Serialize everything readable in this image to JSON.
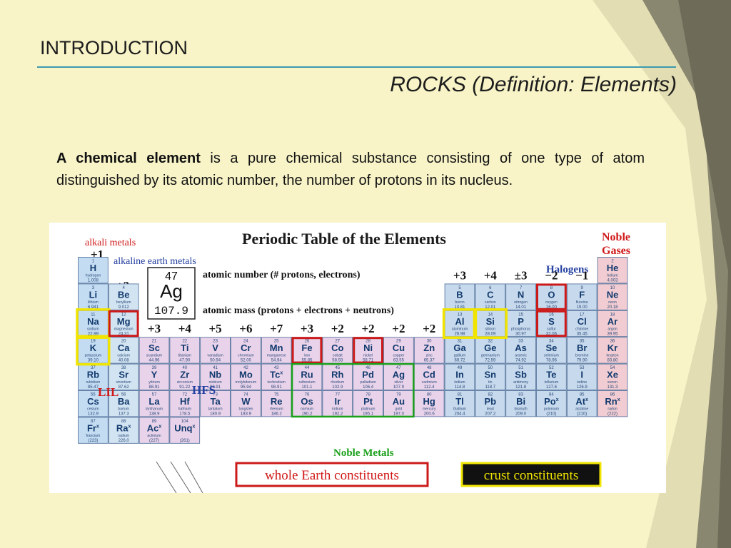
{
  "slide": {
    "title": "INTRODUCTION",
    "subtitle": "ROCKS (Definition: Elements)",
    "paragraph": {
      "term": "A chemical element",
      "rest": " is a pure chemical substance consisting of one type of atom distinguished by its atomic number, the number of protons in its nucleus."
    }
  },
  "table": {
    "title": "Periodic Table of the Elements",
    "alkali_label": "alkali metals",
    "alkaline_label": "alkaline earth metals",
    "noble_label": [
      "Noble",
      "Gases"
    ],
    "halogens_label": "Halogens",
    "noble_metals_label": "Noble Metals",
    "whole_earth_label": "whole Earth constituents",
    "crust_label": "crust constituents",
    "lil_label": "LIL",
    "hfs_label": "HFS",
    "key": {
      "number": "47",
      "symbol": "Ag",
      "mass": "107.9",
      "number_desc": "atomic number (# protons, electrons)",
      "mass_desc": "atomic mass (protons + electrons + neutrons)"
    },
    "charges": {
      "c1": "+1",
      "c2": "+2",
      "t3": "+3",
      "t4": "+4",
      "t5": "+5",
      "t6": "+6",
      "t7": "+7",
      "t8": "+3",
      "t9": "+2",
      "t10": "+2",
      "t11": "+2",
      "t12": "+2",
      "p13": "+3",
      "p14": "+4",
      "p15": "±3",
      "p16": "−2",
      "p17": "−1"
    },
    "colors": {
      "alkali_fill": "#c3dcf2",
      "alkaline_fill": "#d2e4f2",
      "transition_fill": "#e9d3ea",
      "pblock_fill": "#c7d9ec",
      "noble_fill": "#f1ccd2",
      "cell_border": "#4a6a96",
      "highlight_red": "#cc1a1a",
      "highlight_yellow": "#f0e400",
      "noble_metals_green": "#1aa01a"
    },
    "elements": [
      {
        "z": "1",
        "s": "H",
        "n": "hydrogen",
        "m": "1.008",
        "col": 1,
        "row": 1
      },
      {
        "z": "2",
        "s": "He",
        "n": "helium",
        "m": "4.003",
        "col": 18,
        "row": 1
      },
      {
        "z": "3",
        "s": "Li",
        "n": "lithium",
        "m": "6.941",
        "col": 1,
        "row": 2
      },
      {
        "z": "4",
        "s": "Be",
        "n": "beryllium",
        "m": "9.012",
        "col": 2,
        "row": 2
      },
      {
        "z": "5",
        "s": "B",
        "n": "boron",
        "m": "10.81",
        "col": 13,
        "row": 2
      },
      {
        "z": "6",
        "s": "C",
        "n": "carbon",
        "m": "12.01",
        "col": 14,
        "row": 2
      },
      {
        "z": "7",
        "s": "N",
        "n": "nitrogen",
        "m": "14.01",
        "col": 15,
        "row": 2
      },
      {
        "z": "8",
        "s": "O",
        "n": "oxygen",
        "m": "16.00",
        "col": 16,
        "row": 2
      },
      {
        "z": "9",
        "s": "F",
        "n": "fluorine",
        "m": "19.00",
        "col": 17,
        "row": 2
      },
      {
        "z": "10",
        "s": "Ne",
        "n": "neon",
        "m": "20.18",
        "col": 18,
        "row": 2
      },
      {
        "z": "11",
        "s": "Na",
        "n": "sodium",
        "m": "22.99",
        "col": 1,
        "row": 3
      },
      {
        "z": "12",
        "s": "Mg",
        "n": "magnesium",
        "m": "24.31",
        "col": 2,
        "row": 3
      },
      {
        "z": "13",
        "s": "Al",
        "n": "aluminum",
        "m": "26.98",
        "col": 13,
        "row": 3
      },
      {
        "z": "14",
        "s": "Si",
        "n": "silicon",
        "m": "28.09",
        "col": 14,
        "row": 3
      },
      {
        "z": "15",
        "s": "P",
        "n": "phosphorus",
        "m": "30.97",
        "col": 15,
        "row": 3
      },
      {
        "z": "16",
        "s": "S",
        "n": "sulfur",
        "m": "32.06",
        "col": 16,
        "row": 3
      },
      {
        "z": "17",
        "s": "Cl",
        "n": "chlorine",
        "m": "35.45",
        "col": 17,
        "row": 3
      },
      {
        "z": "18",
        "s": "Ar",
        "n": "argon",
        "m": "39.95",
        "col": 18,
        "row": 3
      },
      {
        "z": "19",
        "s": "K",
        "n": "potassium",
        "m": "39.10",
        "col": 1,
        "row": 4
      },
      {
        "z": "20",
        "s": "Ca",
        "n": "calcium",
        "m": "40.08",
        "col": 2,
        "row": 4
      },
      {
        "z": "21",
        "s": "Sc",
        "n": "scandium",
        "m": "44.96",
        "col": 3,
        "row": 4
      },
      {
        "z": "22",
        "s": "Ti",
        "n": "titanium",
        "m": "47.90",
        "col": 4,
        "row": 4
      },
      {
        "z": "23",
        "s": "V",
        "n": "vanadium",
        "m": "50.94",
        "col": 5,
        "row": 4
      },
      {
        "z": "24",
        "s": "Cr",
        "n": "chromium",
        "m": "52.00",
        "col": 6,
        "row": 4
      },
      {
        "z": "25",
        "s": "Mn",
        "n": "manganese",
        "m": "54.94",
        "col": 7,
        "row": 4
      },
      {
        "z": "26",
        "s": "Fe",
        "n": "iron",
        "m": "55.85",
        "col": 8,
        "row": 4
      },
      {
        "z": "27",
        "s": "Co",
        "n": "cobalt",
        "m": "58.93",
        "col": 9,
        "row": 4
      },
      {
        "z": "28",
        "s": "Ni",
        "n": "nickel",
        "m": "58.71",
        "col": 10,
        "row": 4
      },
      {
        "z": "29",
        "s": "Cu",
        "n": "copper",
        "m": "63.55",
        "col": 11,
        "row": 4
      },
      {
        "z": "30",
        "s": "Zn",
        "n": "zinc",
        "m": "65.37",
        "col": 12,
        "row": 4
      },
      {
        "z": "31",
        "s": "Ga",
        "n": "gallium",
        "m": "69.72",
        "col": 13,
        "row": 4
      },
      {
        "z": "32",
        "s": "Ge",
        "n": "germanium",
        "m": "72.59",
        "col": 14,
        "row": 4
      },
      {
        "z": "33",
        "s": "As",
        "n": "arsenic",
        "m": "74.92",
        "col": 15,
        "row": 4
      },
      {
        "z": "34",
        "s": "Se",
        "n": "selenium",
        "m": "78.96",
        "col": 16,
        "row": 4
      },
      {
        "z": "35",
        "s": "Br",
        "n": "bromine",
        "m": "79.90",
        "col": 17,
        "row": 4
      },
      {
        "z": "36",
        "s": "Kr",
        "n": "krypton",
        "m": "83.80",
        "col": 18,
        "row": 4
      },
      {
        "z": "37",
        "s": "Rb",
        "n": "rubidium",
        "m": "85.47",
        "col": 1,
        "row": 5
      },
      {
        "z": "38",
        "s": "Sr",
        "n": "strontium",
        "m": "87.62",
        "col": 2,
        "row": 5
      },
      {
        "z": "39",
        "s": "Y",
        "n": "yttrium",
        "m": "88.91",
        "col": 3,
        "row": 5
      },
      {
        "z": "40",
        "s": "Zr",
        "n": "zirconium",
        "m": "91.22",
        "col": 4,
        "row": 5
      },
      {
        "z": "41",
        "s": "Nb",
        "n": "niobium",
        "m": "92.91",
        "col": 5,
        "row": 5
      },
      {
        "z": "42",
        "s": "Mo",
        "n": "molybdenum",
        "m": "95.94",
        "col": 6,
        "row": 5
      },
      {
        "z": "43",
        "s": "Tc",
        "n": "technetium",
        "m": "98.91",
        "col": 7,
        "row": 5,
        "sup": "x"
      },
      {
        "z": "44",
        "s": "Ru",
        "n": "ruthenium",
        "m": "101.1",
        "col": 8,
        "row": 5
      },
      {
        "z": "45",
        "s": "Rh",
        "n": "rhodium",
        "m": "102.9",
        "col": 9,
        "row": 5
      },
      {
        "z": "46",
        "s": "Pd",
        "n": "palladium",
        "m": "106.4",
        "col": 10,
        "row": 5
      },
      {
        "z": "47",
        "s": "Ag",
        "n": "silver",
        "m": "107.9",
        "col": 11,
        "row": 5
      },
      {
        "z": "48",
        "s": "Cd",
        "n": "cadmium",
        "m": "112.4",
        "col": 12,
        "row": 5
      },
      {
        "z": "49",
        "s": "In",
        "n": "indium",
        "m": "114.8",
        "col": 13,
        "row": 5
      },
      {
        "z": "50",
        "s": "Sn",
        "n": "tin",
        "m": "118.7",
        "col": 14,
        "row": 5
      },
      {
        "z": "51",
        "s": "Sb",
        "n": "antimony",
        "m": "121.8",
        "col": 15,
        "row": 5
      },
      {
        "z": "52",
        "s": "Te",
        "n": "tellurium",
        "m": "127.6",
        "col": 16,
        "row": 5
      },
      {
        "z": "53",
        "s": "I",
        "n": "iodine",
        "m": "126.9",
        "col": 17,
        "row": 5
      },
      {
        "z": "54",
        "s": "Xe",
        "n": "xenon",
        "m": "131.3",
        "col": 18,
        "row": 5
      },
      {
        "z": "55",
        "s": "Cs",
        "n": "cesium",
        "m": "132.9",
        "col": 1,
        "row": 6
      },
      {
        "z": "56",
        "s": "Ba",
        "n": "barium",
        "m": "137.3",
        "col": 2,
        "row": 6
      },
      {
        "z": "57",
        "s": "La",
        "n": "lanthanum",
        "m": "138.9",
        "col": 3,
        "row": 6
      },
      {
        "z": "72",
        "s": "Hf",
        "n": "hafnium",
        "m": "178.5",
        "col": 4,
        "row": 6
      },
      {
        "z": "73",
        "s": "Ta",
        "n": "tantalum",
        "m": "180.9",
        "col": 5,
        "row": 6
      },
      {
        "z": "74",
        "s": "W",
        "n": "tungsten",
        "m": "183.9",
        "col": 6,
        "row": 6
      },
      {
        "z": "75",
        "s": "Re",
        "n": "rhenium",
        "m": "186.2",
        "col": 7,
        "row": 6
      },
      {
        "z": "76",
        "s": "Os",
        "n": "osmium",
        "m": "190.2",
        "col": 8,
        "row": 6
      },
      {
        "z": "77",
        "s": "Ir",
        "n": "iridium",
        "m": "192.2",
        "col": 9,
        "row": 6
      },
      {
        "z": "78",
        "s": "Pt",
        "n": "platinum",
        "m": "195.1",
        "col": 10,
        "row": 6
      },
      {
        "z": "79",
        "s": "Au",
        "n": "gold",
        "m": "197.0",
        "col": 11,
        "row": 6
      },
      {
        "z": "80",
        "s": "Hg",
        "n": "mercury",
        "m": "200.6",
        "col": 12,
        "row": 6
      },
      {
        "z": "81",
        "s": "Tl",
        "n": "thallium",
        "m": "204.4",
        "col": 13,
        "row": 6
      },
      {
        "z": "82",
        "s": "Pb",
        "n": "lead",
        "m": "207.2",
        "col": 14,
        "row": 6
      },
      {
        "z": "83",
        "s": "Bi",
        "n": "bismuth",
        "m": "209.0",
        "col": 15,
        "row": 6
      },
      {
        "z": "84",
        "s": "Po",
        "n": "polonium",
        "m": "(210)",
        "col": 16,
        "row": 6,
        "sup": "x"
      },
      {
        "z": "85",
        "s": "At",
        "n": "astatine",
        "m": "(210)",
        "col": 17,
        "row": 6,
        "sup": "x"
      },
      {
        "z": "86",
        "s": "Rn",
        "n": "radon",
        "m": "(222)",
        "col": 18,
        "row": 6,
        "sup": "x"
      },
      {
        "z": "87",
        "s": "Fr",
        "n": "francium",
        "m": "(223)",
        "col": 1,
        "row": 7,
        "sup": "x"
      },
      {
        "z": "88",
        "s": "Ra",
        "n": "radium",
        "m": "226.0",
        "col": 2,
        "row": 7,
        "sup": "x"
      },
      {
        "z": "89",
        "s": "Ac",
        "n": "actinium",
        "m": "(227)",
        "col": 3,
        "row": 7,
        "sup": "x"
      },
      {
        "z": "104",
        "s": "Unq",
        "n": "",
        "m": "(261)",
        "col": 4,
        "row": 7,
        "sup": "x"
      }
    ],
    "red_boxes": [
      [
        2,
        3
      ],
      [
        8,
        4
      ],
      [
        10,
        4
      ],
      [
        16,
        2
      ],
      [
        16,
        3
      ]
    ],
    "yellow_boxes": [
      [
        1,
        3
      ],
      [
        1,
        4
      ],
      [
        13,
        3
      ],
      [
        14,
        3
      ]
    ]
  }
}
